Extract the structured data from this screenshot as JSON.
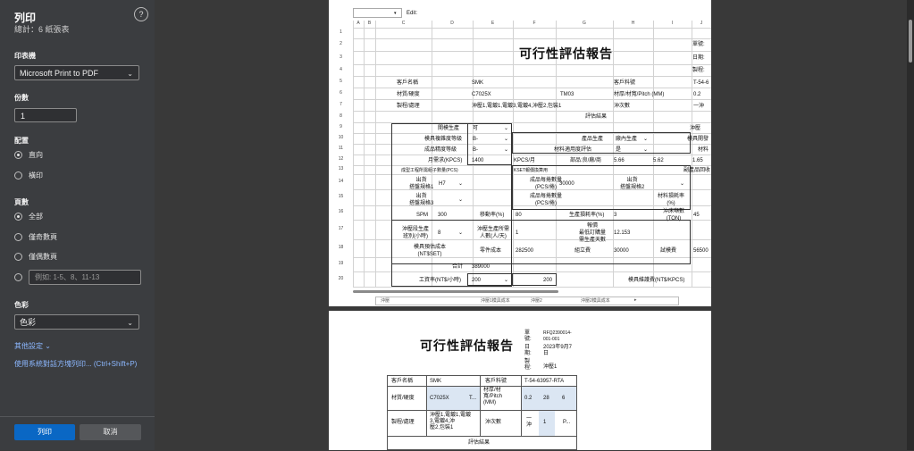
{
  "panel": {
    "title": "列印",
    "subtitle": "總計：6 紙張表",
    "help_icon": "?",
    "printer_label": "印表機",
    "printer_value": "Microsoft Print to PDF",
    "copies_label": "份數",
    "copies_value": "1",
    "layout_label": "配置",
    "layout_options": [
      "直向",
      "橫印"
    ],
    "pages_label": "頁數",
    "pages_options": [
      "全部",
      "僅奇數頁",
      "僅偶數頁"
    ],
    "pages_range_placeholder": "例如: 1-5、8、11-13",
    "color_label": "色彩",
    "color_value": "色彩",
    "more_settings": "其他設定",
    "system_dialog_link": "使用系統對話方塊列印... (Ctrl+Shift+P)",
    "print_button": "列印",
    "cancel_button": "取消"
  },
  "sheet": {
    "edit_label": "Edit:",
    "columns": [
      "A",
      "B",
      "C",
      "D",
      "E",
      "F",
      "G",
      "H",
      "I",
      "J"
    ],
    "rows": [
      "1",
      "2",
      "3",
      "4",
      "5",
      "6",
      "7",
      "8",
      "9",
      "10",
      "11",
      "12",
      "13",
      "14",
      "15",
      "16",
      "17",
      "18",
      "19",
      "20"
    ],
    "title": "可行性評估報告",
    "right_labels": [
      "單號:",
      "日期:",
      "製程:"
    ],
    "customer_name_label": "客戶名稱",
    "customer_name": "SMK",
    "customer_part_label": "客戶料號",
    "customer_part": "T-54-6",
    "material_label": "材質/硬度",
    "material": "C7025X",
    "tm": "TM03",
    "thickness_label": "材厚/材寬/Pitch (MM)",
    "thickness": "0.2",
    "process_label": "製程/處理",
    "process": "沖壓1,電鍍1,電鍍3,電鍍4,沖壓2,包裝1",
    "punch_count_label": "沖次數",
    "punch_count": "一沖",
    "eval_result": "評估結果",
    "open_mold_label": "開模生產",
    "open_mold": "可",
    "mold_grade_label": "模具複雜度等級",
    "mold_grade": "B-",
    "product_grade_label": "成品精度等級",
    "product_grade": "B-",
    "production_label": "產品生產",
    "production": "廠內生產",
    "material_fit_label": "材料適用度評估",
    "material_fit": "是",
    "monthly_label": "月需求(KPCS)",
    "monthly": "1400",
    "kpcs_month": "KPCS/月",
    "part_label": "部品:良/廠/商",
    "part_val1": "5.66",
    "part_val2": "5.62",
    "part_val3": "1.65",
    "kset_label": "KSET報價換算用",
    "sub_mold_label": "成型工程所需組子數量(PCS)",
    "ship_spec1_label": "出貨\n搭盤規格1",
    "ship_spec1": "H7",
    "product_count_label": "成品每捲數量\n(PCS/捲)",
    "product_count": "30000",
    "ship_spec2_label": "出貨\n搭盤規格2",
    "ship_spec3_label": "出貨\n搭盤規格3",
    "product_count2_label": "成品每捲數量\n(PCS/捲)",
    "material_loss_label": "材料損耗率\n(%)",
    "spm_label": "SPM",
    "spm": "300",
    "move_rate_label": "移動率(%)",
    "move_rate": "80",
    "prod_loss_label": "生產損耗率(%)",
    "prod_loss": "3",
    "punch_tonnage_label": "沖床噸數\n(TON)",
    "punch_tonnage": "45",
    "mold_change_label": "沖壓段生產\n班別(小時)",
    "mold_change": "8",
    "punch_people_label": "沖壓生產所需\n人數(人/天)",
    "punch_people": "1",
    "quote_min_label": "報價\n最低訂購量\n需生產天數",
    "quote_min": "12.153",
    "mold_cost_label": "模具預估成本\n(NT$SET)",
    "parts_cost_label": "零件成本",
    "parts_cost": "282500",
    "assembly_label": "組立費",
    "assembly": "30000",
    "trial_label": "試模費",
    "trial": "56500",
    "total_label": "合計",
    "total": "389000",
    "wage_label": "工資率(NT$/小時)",
    "wage": "200",
    "wage2": "200",
    "mold_maint_label": "模具維護費(NT$/KPCS)",
    "punch_side": "沖壓",
    "mold_dev": "模具開發",
    "material_cost_side": "材料",
    "byproduct": "副產品回收"
  },
  "tabs": [
    "沖壓",
    "沖壓1模具成本",
    "沖壓2",
    "沖壓2模具成本"
  ],
  "page2": {
    "title": "可行性評估報告",
    "order_label": "單\n號:",
    "order_value": "RFQ2390014-\n001-001",
    "date_label": "日\n期:",
    "date_value": "2023年9月7\n日",
    "process_label": "製\n程:",
    "process_value": "沖壓1",
    "customer_name_label": "客戶名稱",
    "customer_name": "SMK",
    "customer_part_label": "客戶料號",
    "customer_part": "T-54-63957-RTA",
    "material_label": "材質/硬度",
    "material": "C7025X",
    "material_suffix": "T...",
    "thickness_label": "材厚/材\n寬/Pitch\n(MM)",
    "thick1": "0.2",
    "thick2": "28",
    "thick3": "6",
    "process_row_label": "製程/處理",
    "process_row": "沖壓1,電鍍1,電鍍\n3,電鍍4,沖\n壓2,包裝1",
    "punch_count_label": "沖次數",
    "punch_count": "一\n沖",
    "punch_num": "1",
    "punch_p": "P...",
    "eval": "評估結果"
  }
}
